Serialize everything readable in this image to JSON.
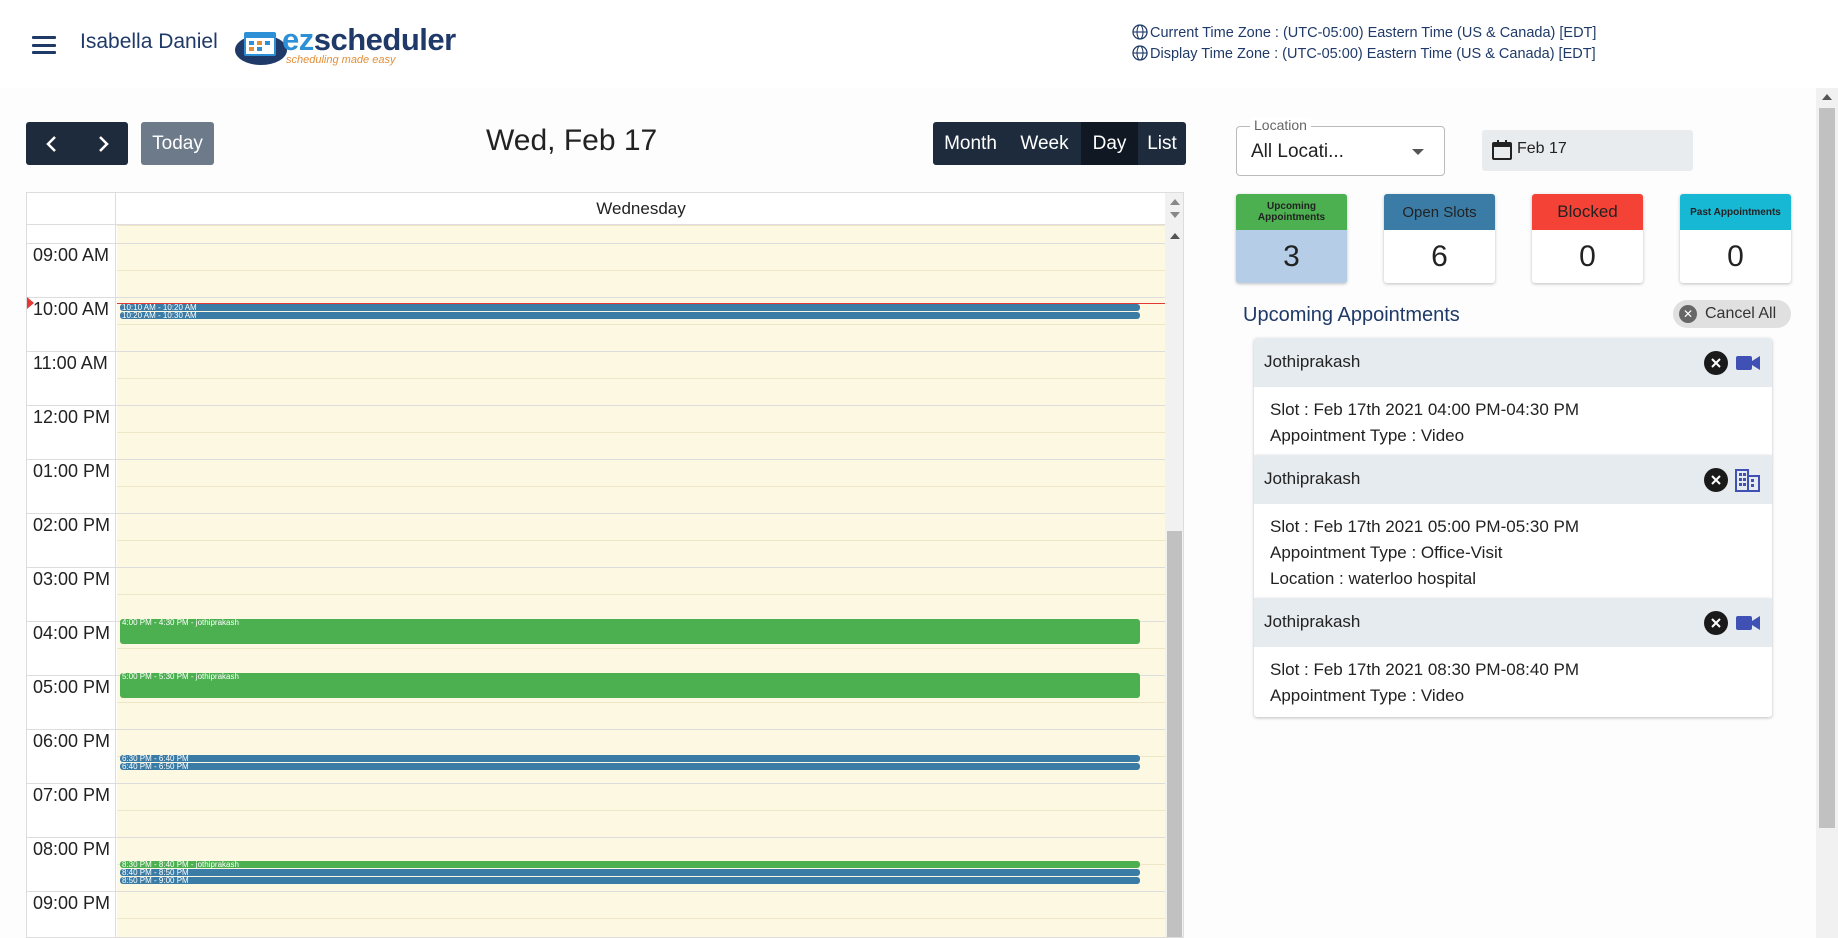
{
  "header": {
    "user_name": "Isabella Daniel",
    "logo_ez": "ez",
    "logo_rest": "scheduler",
    "logo_tagline": "scheduling made easy",
    "current_tz": "Current Time Zone : (UTC-05:00) Eastern Time (US & Canada) [EDT]",
    "display_tz": "Display Time Zone : (UTC-05:00) Eastern Time (US & Canada) [EDT]"
  },
  "toolbar": {
    "today_label": "Today",
    "title": "Wed, Feb 17",
    "views": [
      "Month",
      "Week",
      "Day",
      "List"
    ],
    "active_view": "Day"
  },
  "calendar": {
    "day_header": "Wednesday",
    "hours": [
      "09:00 AM",
      "10:00 AM",
      "11:00 AM",
      "12:00 PM",
      "01:00 PM",
      "02:00 PM",
      "03:00 PM",
      "04:00 PM",
      "05:00 PM",
      "06:00 PM",
      "07:00 PM",
      "08:00 PM",
      "09:00 PM"
    ],
    "events": [
      {
        "label": "10:10 AM - 10:20 AM",
        "kind": "slot"
      },
      {
        "label": "10:20 AM - 10:30 AM",
        "kind": "slot"
      },
      {
        "label": "4:00 PM - 4:30 PM - jothiprakash",
        "kind": "appointment"
      },
      {
        "label": "5:00 PM - 5:30 PM - jothiprakash",
        "kind": "appointment"
      },
      {
        "label": "6:30 PM - 6:40 PM",
        "kind": "slot"
      },
      {
        "label": "6:40 PM - 6:50 PM",
        "kind": "slot"
      },
      {
        "label": "8:30 PM - 8:40 PM - jothiprakash",
        "kind": "appointment"
      },
      {
        "label": "8:40 PM - 8:50 PM",
        "kind": "slot"
      },
      {
        "label": "8:50 PM - 9:00 PM",
        "kind": "slot"
      }
    ]
  },
  "filters": {
    "location_label": "Location",
    "location_value": "All Locati...",
    "date_value": "Feb 17"
  },
  "stats": [
    {
      "label": "Upcoming Appointments",
      "value": "3",
      "color": "#4caf50"
    },
    {
      "label": "Open Slots",
      "value": "6",
      "color": "#3a7ca5"
    },
    {
      "label": "Blocked",
      "value": "0",
      "color": "#f44336"
    },
    {
      "label": "Past Appointments",
      "value": "0",
      "color": "#17b8d4"
    }
  ],
  "upcoming": {
    "title": "Upcoming Appointments",
    "cancel_all_label": "Cancel All",
    "appointments": [
      {
        "name": "Jothiprakash",
        "slot": "Slot : Feb 17th 2021 04:00 PM-04:30 PM",
        "type": "Appointment Type : Video",
        "location": "",
        "icon": "video-icon"
      },
      {
        "name": "Jothiprakash",
        "slot": "Slot : Feb 17th 2021 05:00 PM-05:30 PM",
        "type": "Appointment Type : Office-Visit",
        "location": "Location : waterloo hospital",
        "icon": "building-icon"
      },
      {
        "name": "Jothiprakash",
        "slot": "Slot : Feb 17th 2021 08:30 PM-08:40 PM",
        "type": "Appointment Type : Video",
        "location": "",
        "icon": "video-icon"
      }
    ]
  }
}
